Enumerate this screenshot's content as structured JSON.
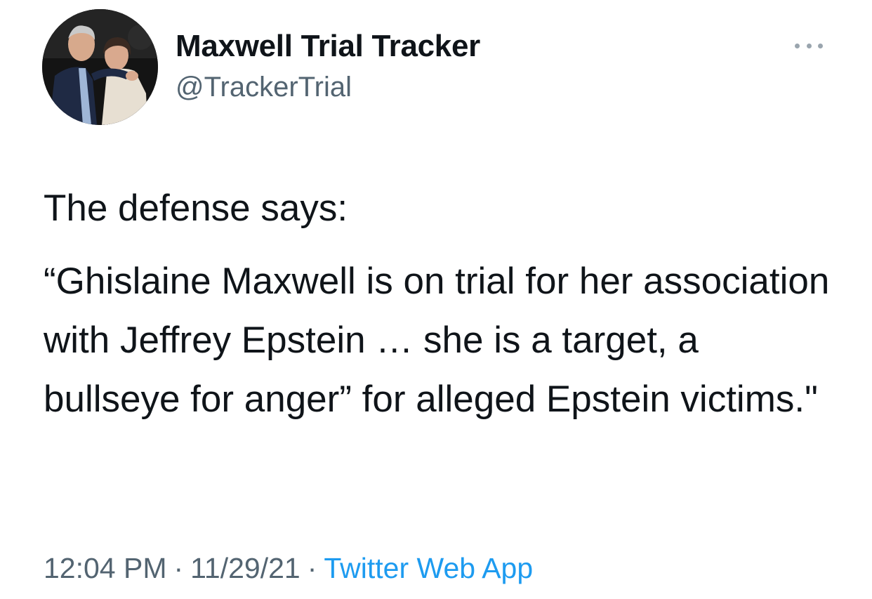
{
  "author": {
    "display_name": "Maxwell Trial Tracker",
    "handle": "@TrackerTrial",
    "avatar_icon": "profile-photo"
  },
  "more_icon": "more-horizontal-icon",
  "tweet": {
    "intro": "The defense says:",
    "quote": "“Ghislaine Maxwell is on trial for her association with Jeffrey Epstein … she is a target, a bullseye for anger” for alleged Epstein victims.\""
  },
  "meta": {
    "time": "12:04 PM",
    "separator": "·",
    "date": "11/29/21",
    "source": "Twitter Web App"
  },
  "colors": {
    "text": "#0f1419",
    "secondary": "#536471",
    "link": "#1d9bf0"
  }
}
